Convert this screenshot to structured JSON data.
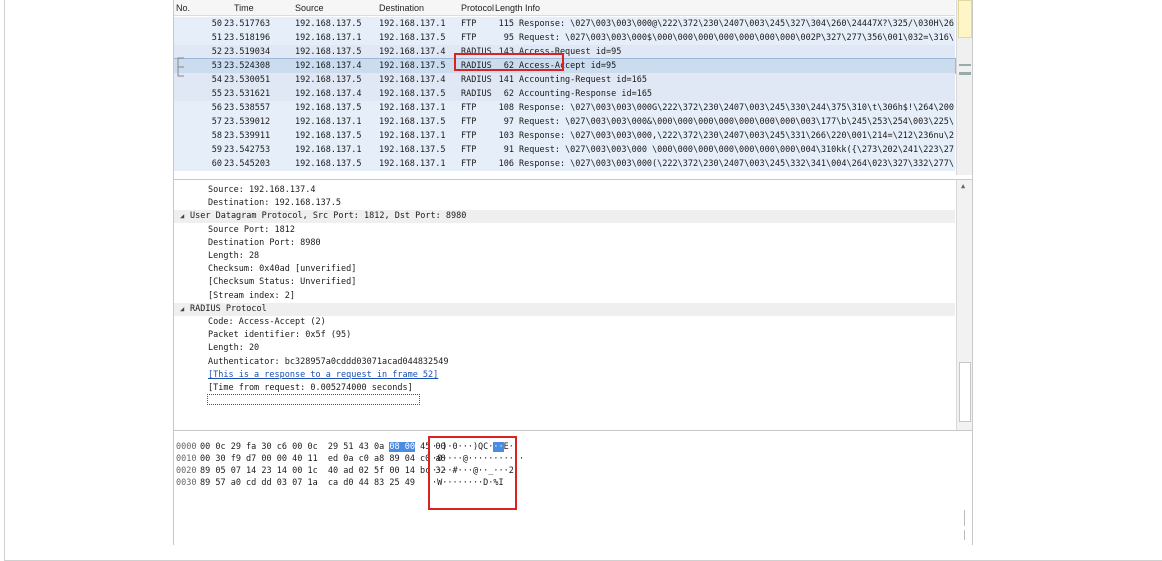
{
  "packet_list": {
    "columns": [
      "No.",
      "Time",
      "Source",
      "Destination",
      "Protocol",
      "Length",
      "Info"
    ],
    "rows": [
      {
        "no": "50",
        "time": "23.517763",
        "src": "192.168.137.5",
        "dst": "192.168.137.1",
        "proto": "FTP",
        "len": "115",
        "info": "Response: \\027\\003\\003\\000@\\222\\372\\230\\2407\\003\\245\\327\\304\\260\\24447X?\\325/\\030H\\265\\364\\247\\220…"
      },
      {
        "no": "51",
        "time": "23.518196",
        "src": "192.168.137.1",
        "dst": "192.168.137.5",
        "proto": "FTP",
        "len": "95",
        "info": "Request: \\027\\003\\003\\000$\\000\\000\\000\\000\\000\\000\\000\\002P\\327\\277\\356\\001\\032=\\316\\0333J\\2216\\246\\321"
      },
      {
        "no": "52",
        "time": "23.519034",
        "src": "192.168.137.5",
        "dst": "192.168.137.4",
        "proto": "RADIUS",
        "len": "143",
        "info": "Access-Request id=95"
      },
      {
        "no": "53",
        "time": "23.524308",
        "src": "192.168.137.4",
        "dst": "192.168.137.5",
        "proto": "RADIUS",
        "len": "62",
        "info": "Access-Accept id=95"
      },
      {
        "no": "54",
        "time": "23.530051",
        "src": "192.168.137.5",
        "dst": "192.168.137.4",
        "proto": "RADIUS",
        "len": "141",
        "info": "Accounting-Request id=165"
      },
      {
        "no": "55",
        "time": "23.531621",
        "src": "192.168.137.4",
        "dst": "192.168.137.5",
        "proto": "RADIUS",
        "len": "62",
        "info": "Accounting-Response id=165"
      },
      {
        "no": "56",
        "time": "23.538557",
        "src": "192.168.137.5",
        "dst": "192.168.137.1",
        "proto": "FTP",
        "len": "108",
        "info": "Response: \\027\\003\\003\\000G\\222\\372\\230\\2407\\003\\245\\330\\244\\375\\310\\t\\306h$!\\264\\200\\212\\334\\020B\\002\\252\\…"
      },
      {
        "no": "57",
        "time": "23.539012",
        "src": "192.168.137.1",
        "dst": "192.168.137.5",
        "proto": "FTP",
        "len": "97",
        "info": "Request: \\027\\003\\003\\000&\\000\\000\\000\\000\\000\\000\\000\\003\\177\\b\\245\\253\\254\\003\\225\\204\\254W88w\\347=\\323\\…"
      },
      {
        "no": "58",
        "time": "23.539911",
        "src": "192.168.137.5",
        "dst": "192.168.137.1",
        "proto": "FTP",
        "len": "103",
        "info": "Response: \\027\\003\\003\\000,\\222\\372\\230\\2407\\003\\245\\331\\266\\220\\001\\214=\\212\\236nu\\217v,\\303\\022\\265\\225-j…"
      },
      {
        "no": "59",
        "time": "23.542753",
        "src": "192.168.137.1",
        "dst": "192.168.137.5",
        "proto": "FTP",
        "len": "91",
        "info": "Request: \\027\\003\\003\\000 \\000\\000\\000\\000\\000\\000\\000\\004\\310kk({\\273\\202\\241\\223\\273\\334\\304x\\267\\350\\026…"
      },
      {
        "no": "60",
        "time": "23.545203",
        "src": "192.168.137.5",
        "dst": "192.168.137.1",
        "proto": "FTP",
        "len": "106",
        "info": "Response: \\027\\003\\003\\000(\\222\\372\\230\\2407\\003\\245\\332\\341\\004\\264\\023\\327\\332\\277\\273"
      }
    ]
  },
  "details": {
    "lines": [
      {
        "text": "Source: 192.168.137.4",
        "level": "sub"
      },
      {
        "text": "Destination: 192.168.137.5",
        "level": "sub"
      },
      {
        "text": "User Datagram Protocol, Src Port: 1812, Dst Port: 8980",
        "level": "top"
      },
      {
        "text": "Source Port: 1812",
        "level": "sub"
      },
      {
        "text": "Destination Port: 8980",
        "level": "sub"
      },
      {
        "text": "Length: 28",
        "level": "sub"
      },
      {
        "text": "Checksum: 0x40ad [unverified]",
        "level": "sub"
      },
      {
        "text": "[Checksum Status: Unverified]",
        "level": "sub"
      },
      {
        "text": "[Stream index: 2]",
        "level": "sub"
      },
      {
        "text": "RADIUS Protocol",
        "level": "top"
      },
      {
        "text": "Code: Access-Accept (2)",
        "level": "sub"
      },
      {
        "text": "Packet identifier: 0x5f (95)",
        "level": "sub"
      },
      {
        "text": "Length: 20",
        "level": "sub"
      },
      {
        "text": "Authenticator: bc328957a0cddd03071acad044832549",
        "level": "sub"
      },
      {
        "text": "[This is a response to a request in frame 52]",
        "level": "sub"
      },
      {
        "text": "[Time from request: 0.005274000 seconds]",
        "level": "sub"
      }
    ]
  },
  "bytes": {
    "rows": [
      {
        "offset": "0000",
        "hex_a": "00 0c 29 fa 30 c6 00 0c  29 51 43 0a ",
        "hex_hl": "08 00",
        "hex_b": " 45 00",
        "ascii_a": "··)·0···)QC·",
        "ascii_hl": "··",
        "ascii_b": "E·"
      },
      {
        "offset": "0010",
        "hex_a": "00 30 f9 d7 00 00 40 11  ed 0a c0 a8 89 04 c0 a8",
        "hex_hl": "",
        "hex_b": "",
        "ascii_a": "·0····@···········",
        "ascii_hl": "",
        "ascii_b": ""
      },
      {
        "offset": "0020",
        "hex_a": "89 05 07 14 23 14 00 1c  40 ad 02 5f 00 14 bc 32",
        "hex_hl": "",
        "hex_b": "",
        "ascii_a": "····#···@··_···2",
        "ascii_hl": "",
        "ascii_b": ""
      },
      {
        "offset": "0030",
        "hex_a": "89 57 a0 cd dd 03 07 1a  ca d0 44 83 25 49",
        "hex_hl": "",
        "hex_b": "",
        "ascii_a": "·W········D·%I",
        "ascii_hl": "",
        "ascii_b": ""
      }
    ]
  },
  "icons": {
    "scroll_up": "▲",
    "expander_open": "◢"
  },
  "colors": {
    "annotation_red": "#d92222",
    "byte_highlight": "#4b8ce3",
    "selected_row": "#cbdcef",
    "link": "#1a4fb4"
  }
}
